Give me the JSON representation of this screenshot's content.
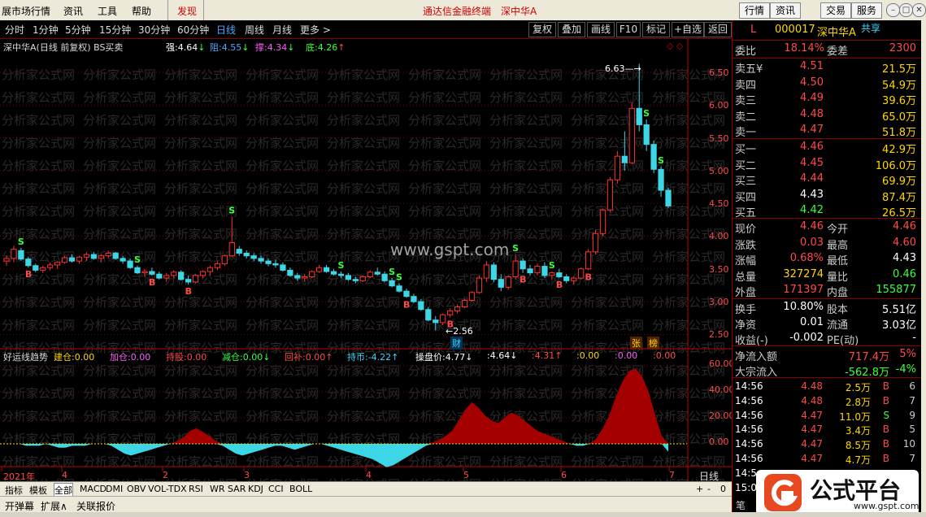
{
  "menu": {
    "items": [
      "展市场行情",
      "资讯",
      "工具",
      "帮助",
      "发现"
    ],
    "center": [
      "通达信金融终端",
      "深中华A"
    ],
    "sys_buttons": [
      "行情",
      "资讯",
      "交易",
      "服务"
    ]
  },
  "periods": {
    "items": [
      "分时",
      "1分钟",
      "5分钟",
      "15分钟",
      "30分钟",
      "60分钟",
      "日线",
      "周线",
      "月线",
      "更多 >"
    ],
    "selected": "日线",
    "tools": [
      "复权",
      "叠加",
      "画线",
      "F10",
      "标记",
      "+自选",
      "返回"
    ]
  },
  "main_chart": {
    "title": "深中华A(日线 前复权) BS买卖",
    "indicators": [
      {
        "label": "强:",
        "value": "4.64",
        "arrow": "↓",
        "color": "#ffffff"
      },
      {
        "label": "阻:",
        "value": "4.55",
        "arrow": "↓",
        "color": "#4fa8ff"
      },
      {
        "label": "撑:",
        "value": "4.34",
        "arrow": "↓",
        "color": "#ff5cff"
      },
      {
        "label": "底:",
        "value": "4.26",
        "arrow": "↑",
        "color": "#3cff3c"
      }
    ],
    "price_axis": [
      "6.50",
      "6.00",
      "5.50",
      "5.00",
      "4.50",
      "4.00",
      "3.50",
      "3.00",
      "2.50"
    ],
    "high_annot": "6.63",
    "low_annot": "2.56",
    "watermark_url": "www.gspt.com",
    "watermark_text": "分析家公式网",
    "markers": {
      "cai": "财",
      "zhang": "张",
      "bang": "榜"
    }
  },
  "sub_chart": {
    "title": "好运线趋势",
    "items": [
      {
        "label": "建仓:",
        "value": "0.00",
        "color": "#ffd700"
      },
      {
        "label": "加仓:",
        "value": "0.00",
        "color": "#ff5cff"
      },
      {
        "label": "持股:",
        "value": "0.00",
        "color": "#ff4a4a"
      },
      {
        "label": "减仓:",
        "value": "0.00",
        "color": "#3cff3c",
        "arrow": "↓"
      },
      {
        "label": "回补:",
        "value": "0.00",
        "color": "#ff4a4a",
        "arrow": "↑"
      },
      {
        "label": "持币:",
        "value": "-4.22",
        "color": "#3cd6ff",
        "arrow": "↑"
      },
      {
        "label": "操盘价:",
        "value": "4.77",
        "color": "#ffffff",
        "arrow": "↓"
      },
      {
        "label": ":",
        "value": "4.64",
        "color": "#ffffff",
        "arrow": "↓"
      },
      {
        "label": ":",
        "value": "4.31",
        "color": "#ff4a4a",
        "arrow": "↑"
      },
      {
        "label": ":",
        "value": "0.00",
        "color": "#ffd700"
      },
      {
        "label": ":",
        "value": "0.00",
        "color": "#ff5cff"
      },
      {
        "label": ":",
        "value": "0.00",
        "color": "#ff4a4a"
      }
    ],
    "axis": [
      "60.00",
      "40.00",
      "20.00",
      "0.00"
    ]
  },
  "time_axis": {
    "labels": [
      "2021年",
      "4",
      "2",
      "3",
      "4",
      "5",
      "6",
      "7"
    ],
    "period": "日线"
  },
  "indicator_tabs": [
    "指标",
    "模板",
    "全部",
    "MACD",
    "DMI",
    "OBV",
    "VOL-TDX",
    "RSI",
    "WR",
    "SAR",
    "KDJ",
    "CCI",
    "BOLL"
  ],
  "indicator_controls": [
    "+",
    "-",
    "0"
  ],
  "status_tabs": [
    "开弹幕",
    "扩展∧",
    "关联报价"
  ],
  "quote": {
    "flag": "L",
    "code": "000017",
    "name": "深中华A",
    "share": "共享",
    "weibi_label": "委比",
    "weibi": "18.14%",
    "weicha_label": "委差",
    "weicha": "2300",
    "sell": [
      {
        "label": "卖五",
        "mark": "¥",
        "price": "4.51",
        "vol": "21.5万"
      },
      {
        "label": "卖四",
        "price": "4.50",
        "vol": "54.9万"
      },
      {
        "label": "卖三",
        "price": "4.49",
        "vol": "39.6万"
      },
      {
        "label": "卖二",
        "price": "4.48",
        "vol": "65.0万"
      },
      {
        "label": "卖一",
        "price": "4.47",
        "vol": "51.8万"
      }
    ],
    "buy": [
      {
        "label": "买一",
        "price": "4.46",
        "vol": "42.9万"
      },
      {
        "label": "买二",
        "price": "4.45",
        "vol": "106.0万"
      },
      {
        "label": "买三",
        "price": "4.44",
        "vol": "69.9万"
      },
      {
        "label": "买四",
        "price": "4.43",
        "vol": "87.4万"
      },
      {
        "label": "买五",
        "price": "4.42",
        "vol": "26.5万"
      }
    ],
    "stats": [
      {
        "l1": "现价",
        "v1": "4.46",
        "c1": "up",
        "l2": "今开",
        "v2": "4.46",
        "c2": "up"
      },
      {
        "l1": "涨跌",
        "v1": "0.03",
        "c1": "up",
        "l2": "最高",
        "v2": "4.60",
        "c2": "up"
      },
      {
        "l1": "涨幅",
        "v1": "0.68%",
        "c1": "up",
        "l2": "最低",
        "v2": "4.43",
        "c2": "wh"
      },
      {
        "l1": "总量",
        "v1": "327274",
        "c1": "yl",
        "l2": "量比",
        "v2": "0.46",
        "c2": "dn"
      },
      {
        "l1": "外盘",
        "v1": "171397",
        "c1": "up",
        "l2": "内盘",
        "v2": "155877",
        "c2": "dn"
      }
    ],
    "stats2": [
      {
        "l1": "换手",
        "v1": "10.80%",
        "c1": "wh",
        "l2": "股本",
        "v2": "5.51亿",
        "c2": "wh"
      },
      {
        "l1": "净资",
        "v1": "0.01",
        "c1": "wh",
        "l2": "流通",
        "v2": "3.03亿",
        "c2": "wh"
      },
      {
        "l1": "收益(-)",
        "v1": "-0.002",
        "c1": "wh",
        "l2": "PE(动)",
        "v2": "-",
        "c2": "wh"
      }
    ],
    "flow": [
      {
        "label": "净流入额",
        "value": "717.4万",
        "pct": "5%",
        "c": "up"
      },
      {
        "label": "大宗流入",
        "value": "-562.8万",
        "pct": "-4%",
        "c": "dn"
      }
    ],
    "ticks": [
      {
        "time": "14:56",
        "price": "4.48",
        "vol": "2.5万",
        "bs": "B",
        "n": "6"
      },
      {
        "time": "14:56",
        "price": "4.48",
        "vol": "2.8万",
        "bs": "B",
        "n": "7"
      },
      {
        "time": "14:56",
        "price": "4.47",
        "vol": "11.0万",
        "bs": "S",
        "n": "9"
      },
      {
        "time": "14:56",
        "price": "4.47",
        "vol": "3.4万",
        "bs": "B",
        "n": "5"
      },
      {
        "time": "14:56",
        "price": "4.47",
        "vol": "8.5万",
        "bs": "B",
        "n": "10"
      },
      {
        "time": "14:56",
        "price": "4.47",
        "vol": "4.7万",
        "bs": "B",
        "n": "7"
      },
      {
        "time": "14:5",
        "price": "",
        "vol": "",
        "bs": "",
        "n": ""
      },
      {
        "time": "15:0",
        "price": "",
        "vol": "",
        "bs": "",
        "n": ""
      }
    ],
    "bottom_tab": "笔"
  },
  "logo": {
    "title": "公式平台",
    "url": "www.gspt.com"
  },
  "colors": {
    "up": "#ff3030",
    "down": "#3cd6e6",
    "grid": "#7a0000",
    "axis": "#c00000"
  },
  "chart_data": [
    {
      "type": "candlestick",
      "title": "深中华A(日线 前复权) BS买卖",
      "ylim": [
        2.4,
        6.7
      ],
      "candles": [
        [
          3.62,
          3.7,
          3.55,
          3.66
        ],
        [
          3.66,
          3.85,
          3.6,
          3.8
        ],
        [
          3.78,
          3.82,
          3.62,
          3.65
        ],
        [
          3.65,
          3.68,
          3.52,
          3.55
        ],
        [
          3.55,
          3.58,
          3.45,
          3.48
        ],
        [
          3.48,
          3.55,
          3.44,
          3.52
        ],
        [
          3.52,
          3.6,
          3.48,
          3.56
        ],
        [
          3.56,
          3.62,
          3.5,
          3.6
        ],
        [
          3.6,
          3.7,
          3.58,
          3.67
        ],
        [
          3.67,
          3.72,
          3.6,
          3.62
        ],
        [
          3.62,
          3.7,
          3.58,
          3.68
        ],
        [
          3.68,
          3.75,
          3.62,
          3.72
        ],
        [
          3.72,
          3.76,
          3.64,
          3.66
        ],
        [
          3.66,
          3.72,
          3.6,
          3.7
        ],
        [
          3.7,
          3.78,
          3.66,
          3.74
        ],
        [
          3.74,
          3.76,
          3.64,
          3.66
        ],
        [
          3.66,
          3.7,
          3.58,
          3.62
        ],
        [
          3.62,
          3.66,
          3.5,
          3.52
        ],
        [
          3.52,
          3.55,
          3.42,
          3.44
        ],
        [
          3.44,
          3.5,
          3.38,
          3.46
        ],
        [
          3.46,
          3.52,
          3.4,
          3.42
        ],
        [
          3.42,
          3.46,
          3.34,
          3.36
        ],
        [
          3.36,
          3.44,
          3.3,
          3.4
        ],
        [
          3.4,
          3.48,
          3.36,
          3.45
        ],
        [
          3.45,
          3.48,
          3.32,
          3.34
        ],
        [
          3.34,
          3.4,
          3.26,
          3.3
        ],
        [
          3.3,
          3.42,
          3.28,
          3.4
        ],
        [
          3.4,
          3.48,
          3.36,
          3.46
        ],
        [
          3.46,
          3.55,
          3.4,
          3.52
        ],
        [
          3.52,
          3.62,
          3.48,
          3.58
        ],
        [
          3.58,
          3.72,
          3.55,
          3.7
        ],
        [
          3.7,
          4.3,
          3.68,
          3.9
        ],
        [
          3.8,
          3.85,
          3.7,
          3.74
        ],
        [
          3.74,
          3.78,
          3.66,
          3.7
        ],
        [
          3.7,
          3.74,
          3.62,
          3.66
        ],
        [
          3.66,
          3.7,
          3.58,
          3.62
        ],
        [
          3.62,
          3.66,
          3.54,
          3.58
        ],
        [
          3.58,
          3.64,
          3.52,
          3.56
        ],
        [
          3.56,
          3.6,
          3.46,
          3.48
        ],
        [
          3.48,
          3.52,
          3.38,
          3.4
        ],
        [
          3.4,
          3.44,
          3.32,
          3.36
        ],
        [
          3.36,
          3.42,
          3.3,
          3.38
        ],
        [
          3.38,
          3.48,
          3.36,
          3.46
        ],
        [
          3.46,
          3.56,
          3.44,
          3.52
        ],
        [
          3.52,
          3.56,
          3.44,
          3.46
        ],
        [
          3.46,
          3.5,
          3.4,
          3.42
        ],
        [
          3.42,
          3.46,
          3.36,
          3.4
        ],
        [
          3.4,
          3.44,
          3.32,
          3.34
        ],
        [
          3.34,
          3.38,
          3.28,
          3.32
        ],
        [
          3.32,
          3.4,
          3.3,
          3.38
        ],
        [
          3.38,
          3.48,
          3.36,
          3.45
        ],
        [
          3.45,
          3.52,
          3.4,
          3.42
        ],
        [
          3.42,
          3.46,
          3.3,
          3.32
        ],
        [
          3.32,
          3.36,
          3.22,
          3.24
        ],
        [
          3.24,
          3.28,
          3.14,
          3.16
        ],
        [
          3.16,
          3.2,
          3.06,
          3.08
        ],
        [
          3.08,
          3.12,
          2.98,
          3.0
        ],
        [
          3.0,
          3.04,
          2.86,
          2.88
        ],
        [
          2.88,
          2.92,
          2.7,
          2.72
        ],
        [
          2.72,
          2.78,
          2.56,
          2.68
        ],
        [
          2.68,
          2.82,
          2.64,
          2.8
        ],
        [
          2.8,
          2.9,
          2.76,
          2.86
        ],
        [
          2.86,
          2.96,
          2.82,
          2.92
        ],
        [
          2.92,
          3.04,
          2.9,
          3.02
        ],
        [
          3.02,
          3.16,
          3.0,
          3.14
        ],
        [
          3.14,
          3.4,
          3.12,
          3.36
        ],
        [
          3.36,
          3.62,
          3.3,
          3.56
        ],
        [
          3.56,
          3.6,
          3.3,
          3.34
        ],
        [
          3.34,
          3.42,
          3.16,
          3.22
        ],
        [
          3.22,
          3.4,
          3.18,
          3.38
        ],
        [
          3.38,
          3.72,
          3.34,
          3.62
        ],
        [
          3.62,
          3.66,
          3.44,
          3.5
        ],
        [
          3.5,
          3.56,
          3.4,
          3.44
        ],
        [
          3.44,
          3.58,
          3.4,
          3.54
        ],
        [
          3.54,
          3.6,
          3.36,
          3.4
        ],
        [
          3.4,
          3.46,
          3.34,
          3.44
        ],
        [
          3.44,
          3.5,
          3.36,
          3.38
        ],
        [
          3.38,
          3.42,
          3.28,
          3.32
        ],
        [
          3.32,
          3.38,
          3.26,
          3.36
        ],
        [
          3.36,
          3.52,
          3.34,
          3.5
        ],
        [
          3.5,
          3.8,
          3.48,
          3.76
        ],
        [
          3.76,
          4.1,
          3.72,
          4.04
        ],
        [
          4.04,
          4.42,
          4.0,
          4.4
        ],
        [
          4.4,
          4.9,
          4.36,
          4.86
        ],
        [
          4.86,
          5.3,
          4.8,
          5.22
        ],
        [
          5.22,
          5.6,
          5.0,
          5.12
        ],
        [
          5.12,
          6.05,
          5.1,
          5.95
        ],
        [
          5.95,
          6.63,
          5.6,
          5.7
        ],
        [
          5.7,
          5.78,
          5.3,
          5.4
        ],
        [
          5.4,
          5.46,
          4.96,
          5.02
        ],
        [
          5.02,
          5.06,
          4.6,
          4.7
        ],
        [
          4.7,
          4.74,
          4.43,
          4.46
        ]
      ]
    },
    {
      "type": "area",
      "title": "好运线趋势",
      "ylim": [
        -5,
        62
      ],
      "values": [
        0,
        0,
        0,
        -1,
        -1,
        -1,
        0,
        -1,
        -2,
        -2,
        -1,
        -1,
        -1,
        0,
        0,
        0,
        -1,
        -3,
        -5,
        -6,
        -5,
        -4,
        -3,
        -2,
        -1,
        0,
        2,
        5,
        10,
        12,
        9,
        6,
        2,
        -1,
        -3,
        -5,
        -6,
        -5,
        -4,
        -3,
        -2,
        -1,
        -1,
        -2,
        -3,
        -2,
        -1,
        0,
        0,
        -1,
        -2,
        -3,
        -4,
        -5,
        -6,
        -7,
        -8,
        -10,
        -12,
        -11,
        -9,
        -7,
        -5,
        -3,
        -1,
        1,
        3,
        6,
        10,
        18,
        26,
        32,
        28,
        22,
        18,
        16,
        20,
        24,
        22,
        18,
        14,
        10,
        8,
        6,
        4,
        2,
        0,
        -1,
        -1,
        0,
        4,
        12,
        22,
        36,
        48,
        56,
        58,
        52,
        40,
        22,
        6,
        -4
      ]
    }
  ]
}
